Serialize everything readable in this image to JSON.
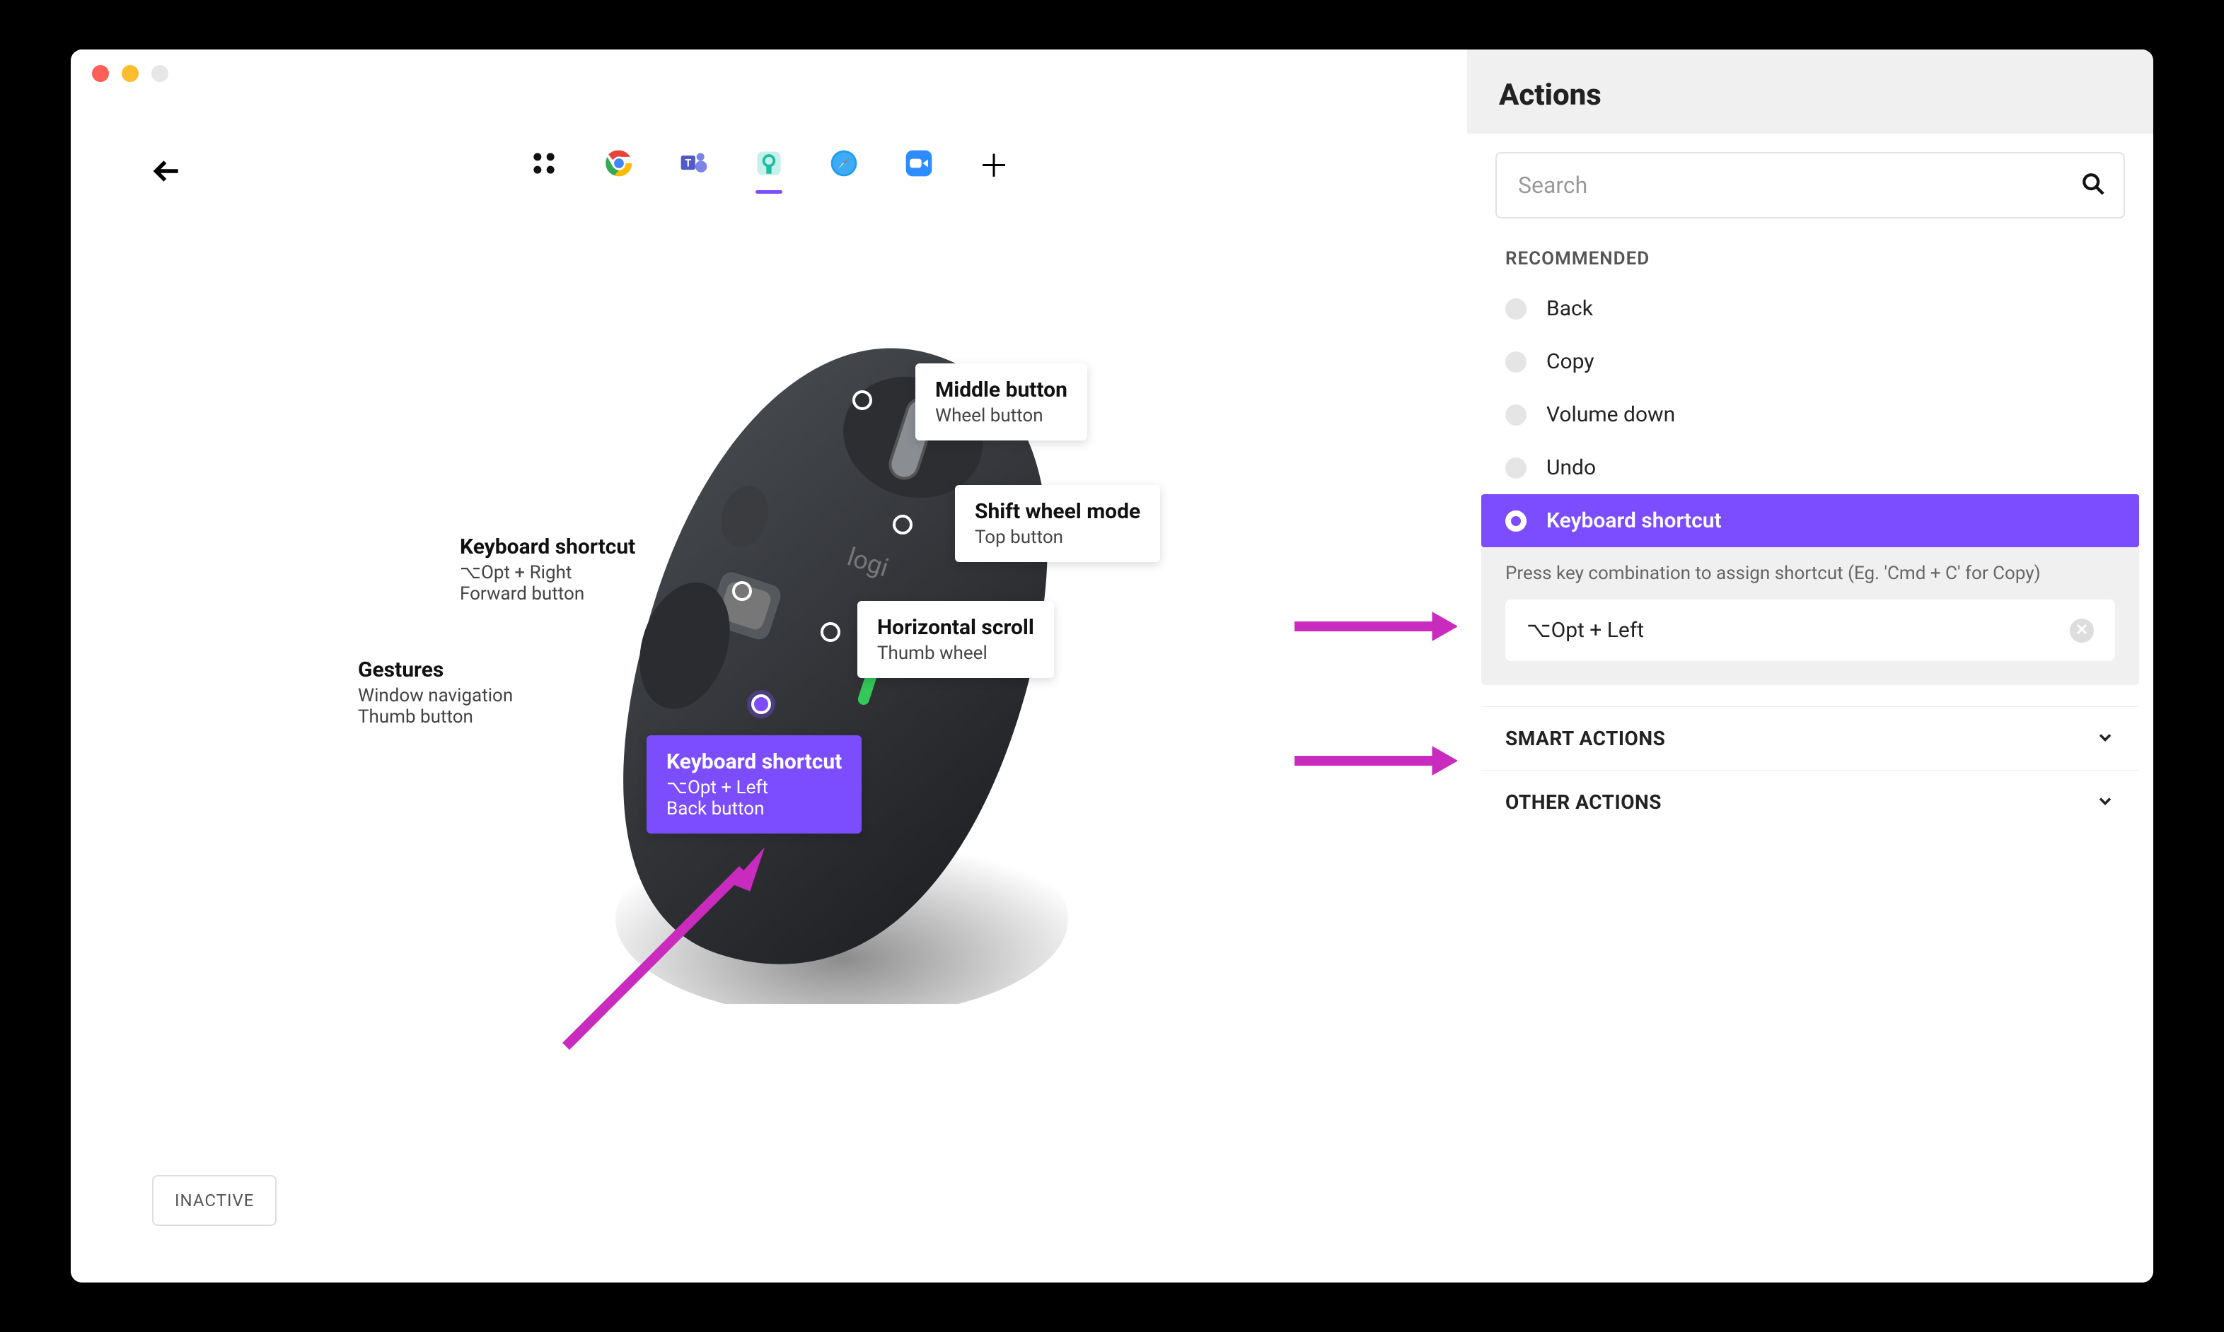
{
  "colors": {
    "accent": "#7c4dff",
    "annotation": "#c92bbf"
  },
  "toolbar": {
    "apps": [
      {
        "name": "all-apps",
        "selected": false
      },
      {
        "name": "chrome",
        "selected": false
      },
      {
        "name": "teams",
        "selected": false
      },
      {
        "name": "logi",
        "selected": true
      },
      {
        "name": "safari",
        "selected": false
      },
      {
        "name": "zoom",
        "selected": false
      }
    ]
  },
  "inactive_label": "INACTIVE",
  "callouts": {
    "middle": {
      "title": "Middle button",
      "sub": "Wheel button"
    },
    "shift": {
      "title": "Shift wheel mode",
      "sub": "Top button"
    },
    "hscroll": {
      "title": "Horizontal scroll",
      "sub": "Thumb wheel"
    },
    "forward": {
      "title": "Keyboard shortcut",
      "sub": "⌥Opt + Right",
      "sub2": "Forward button"
    },
    "gestures": {
      "title": "Gestures",
      "sub": "Window navigation",
      "sub2": "Thumb button"
    },
    "back": {
      "title": "Keyboard shortcut",
      "sub": "⌥Opt + Left",
      "sub2": "Back button"
    }
  },
  "side": {
    "title": "Actions",
    "search_placeholder": "Search",
    "recommended_label": "RECOMMENDED",
    "items": [
      {
        "label": "Back",
        "selected": false
      },
      {
        "label": "Copy",
        "selected": false
      },
      {
        "label": "Volume down",
        "selected": false
      },
      {
        "label": "Undo",
        "selected": false
      },
      {
        "label": "Keyboard shortcut",
        "selected": true
      }
    ],
    "shortcut_hint": "Press key combination to assign shortcut (Eg. 'Cmd + C' for Copy)",
    "shortcut_value": "⌥Opt + Left",
    "smart_label": "SMART ACTIONS",
    "other_label": "OTHER ACTIONS"
  }
}
